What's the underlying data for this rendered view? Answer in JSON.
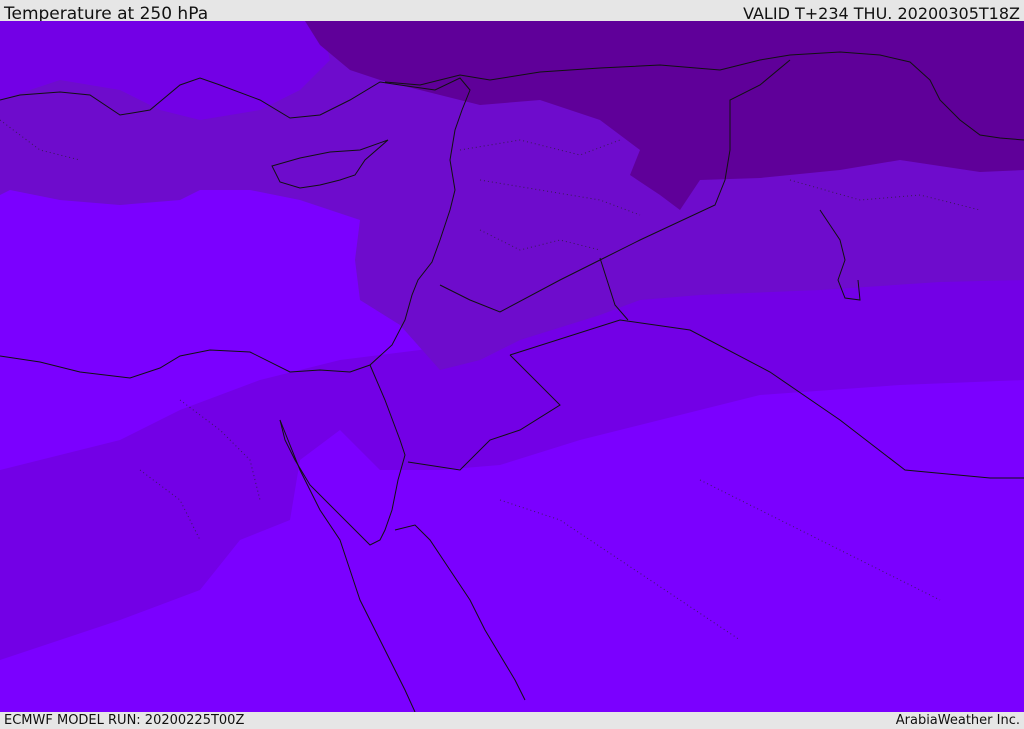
{
  "header": {
    "title": "Temperature at 250 hPa",
    "valid": "VALID T+234 THU. 20200305T18Z"
  },
  "footer": {
    "model_run": "ECMWF MODEL RUN: 20200225T00Z",
    "brand": "ArabiaWeather Inc."
  },
  "colors": {
    "band_warm": "#7b00ff",
    "band_mid": "#7300e6",
    "band_cool": "#6e0ccc",
    "band_cold": "#5f0099",
    "border": "#111111",
    "chrome": "#e6e6e6"
  }
}
